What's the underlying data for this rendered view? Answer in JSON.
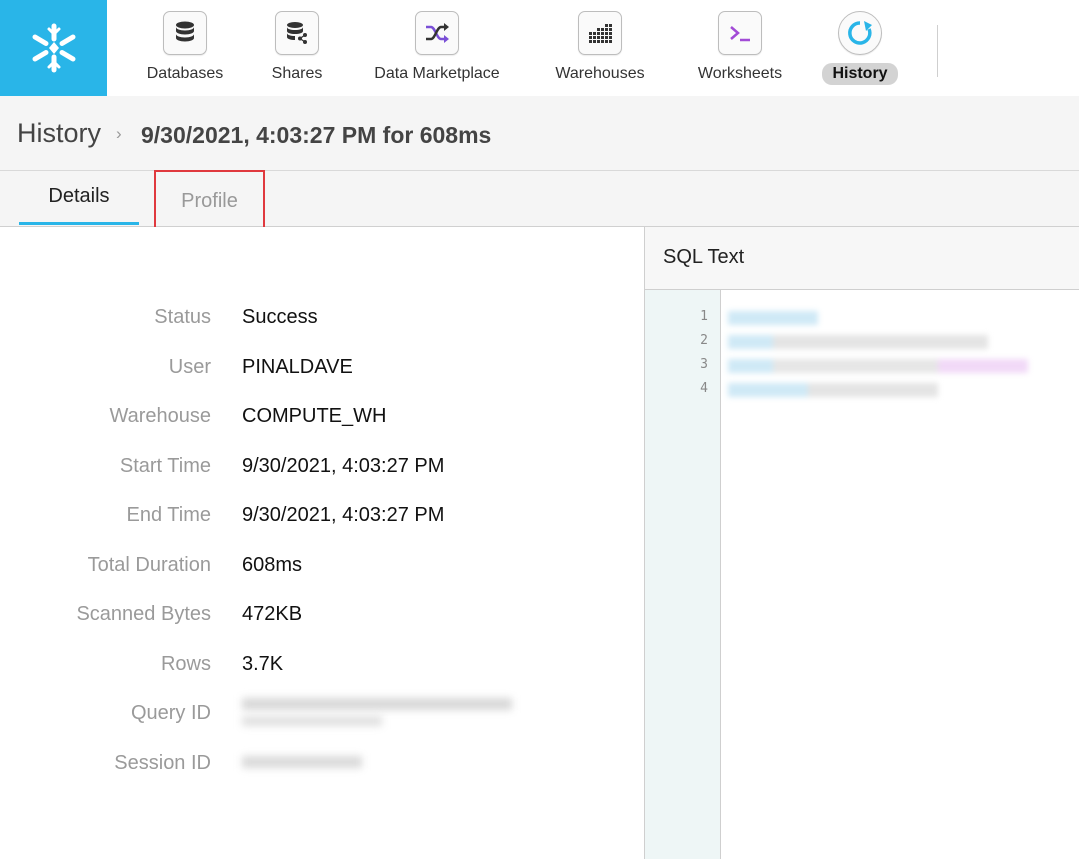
{
  "nav": {
    "items": [
      {
        "label": "Databases",
        "icon": "database-icon"
      },
      {
        "label": "Shares",
        "icon": "share-icon"
      },
      {
        "label": "Data Marketplace",
        "icon": "shuffle-icon"
      },
      {
        "label": "Warehouses",
        "icon": "warehouse-grid-icon"
      },
      {
        "label": "Worksheets",
        "icon": "terminal-icon"
      },
      {
        "label": "History",
        "icon": "history-refresh-icon"
      }
    ],
    "active": "History"
  },
  "breadcrumb": {
    "root": "History",
    "separator": "›",
    "current": "9/30/2021, 4:03:27 PM for 608ms"
  },
  "tabs": [
    {
      "label": "Details",
      "active": true
    },
    {
      "label": "Profile",
      "active": false,
      "highlighted": true
    }
  ],
  "details": [
    {
      "label": "Status",
      "value": "Success"
    },
    {
      "label": "User",
      "value": "PINALDAVE"
    },
    {
      "label": "Warehouse",
      "value": "COMPUTE_WH"
    },
    {
      "label": "Start Time",
      "value": "9/30/2021, 4:03:27 PM"
    },
    {
      "label": "End Time",
      "value": "9/30/2021, 4:03:27 PM"
    },
    {
      "label": "Total Duration",
      "value": "608ms"
    },
    {
      "label": "Scanned Bytes",
      "value": "472KB"
    },
    {
      "label": "Rows",
      "value": "3.7K"
    },
    {
      "label": "Query ID",
      "value": ""
    },
    {
      "label": "Session ID",
      "value": ""
    }
  ],
  "sql": {
    "title": "SQL Text",
    "line_numbers": [
      "1",
      "2",
      "3",
      "4"
    ]
  },
  "colors": {
    "brand": "#29b5e8",
    "highlight_box": "#e0393e"
  }
}
